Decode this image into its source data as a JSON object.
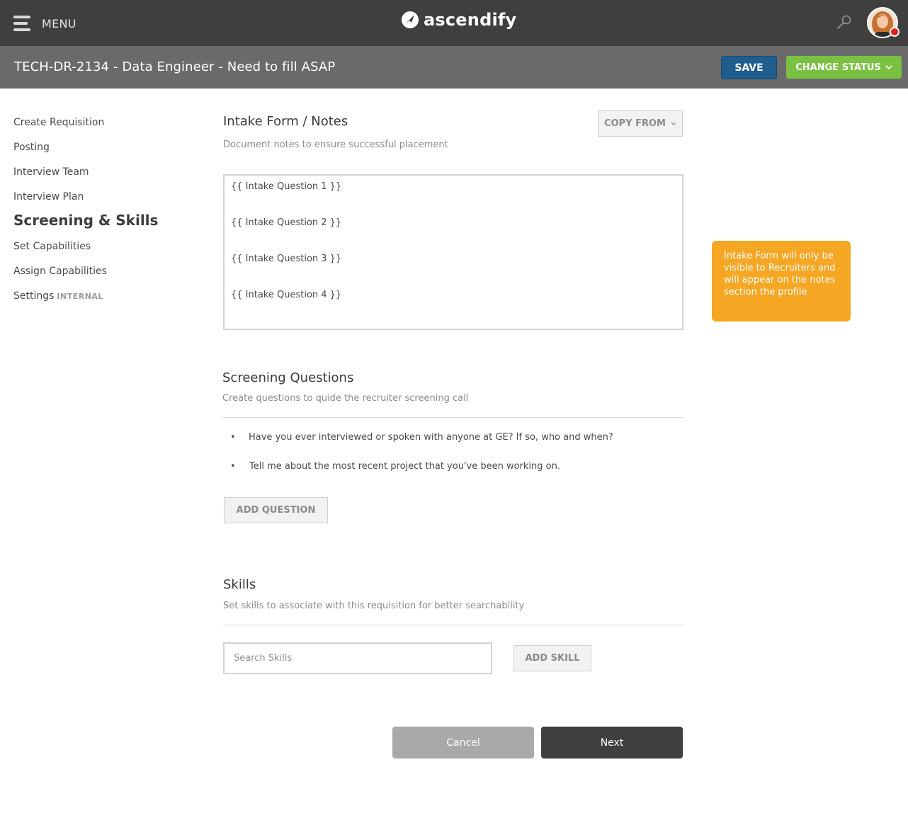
{
  "topbar": {
    "menu_label": "MENU",
    "brand": "ascendify",
    "icons": {
      "menu": "hamburger-icon",
      "logo": "ascendify-logo-icon",
      "search": "search-icon",
      "avatar": "user-avatar",
      "status": "status-dot"
    },
    "status_color": "#e0211b"
  },
  "subbar": {
    "title": "TECH-DR-2134 - Data Engineer - Need to fill ASAP",
    "save_label": "SAVE",
    "change_status_label": "CHANGE STATUS"
  },
  "sidebar": {
    "items": [
      {
        "label": "Create Requisition"
      },
      {
        "label": "Posting"
      },
      {
        "label": "Interview Team"
      },
      {
        "label": "Interview Plan"
      },
      {
        "label": "Screening & Skills",
        "active": true
      },
      {
        "label": "Set Capabilities"
      },
      {
        "label": "Assign Capabilities"
      },
      {
        "label": "Settings",
        "tag": "INTERNAL"
      }
    ]
  },
  "intake": {
    "title": "Intake Form / Notes",
    "subtitle": "Document notes to ensure successful placement",
    "copy_from_label": "COPY FROM",
    "lines": [
      "{{ Intake Question 1 }}",
      "{{ Intake Question 2 }}",
      "{{ Intake Question 3 }}",
      "{{ Intake Question 4 }}"
    ],
    "tooltip": "Intake Form will only be visible to Recruiters and will appear on the notes section the profile"
  },
  "screening": {
    "title": "Screening Questions",
    "subtitle": "Create questions to quide the recruiter screening call",
    "bullet": "•",
    "questions": [
      "Have you ever interviewed or spoken with anyone at GE? If so, who and when?",
      "Tell me about the most recent project that you've been working on."
    ],
    "add_label": "ADD QUESTION"
  },
  "skills": {
    "title": "Skills",
    "subtitle": "Set skills to associate with this requisition for better searchability",
    "search_placeholder": "Search Skills",
    "add_label": "ADD SKILL"
  },
  "footer": {
    "cancel_label": "Cancel",
    "next_label": "Next"
  },
  "colors": {
    "topbar": "#3f3f3f",
    "subbar": "#6a6a6a",
    "save": "#1f5d8e",
    "change_status": "#7ac143",
    "tooltip": "#f5a623",
    "next": "#3f3f3f",
    "cancel": "#a9a9a9"
  }
}
